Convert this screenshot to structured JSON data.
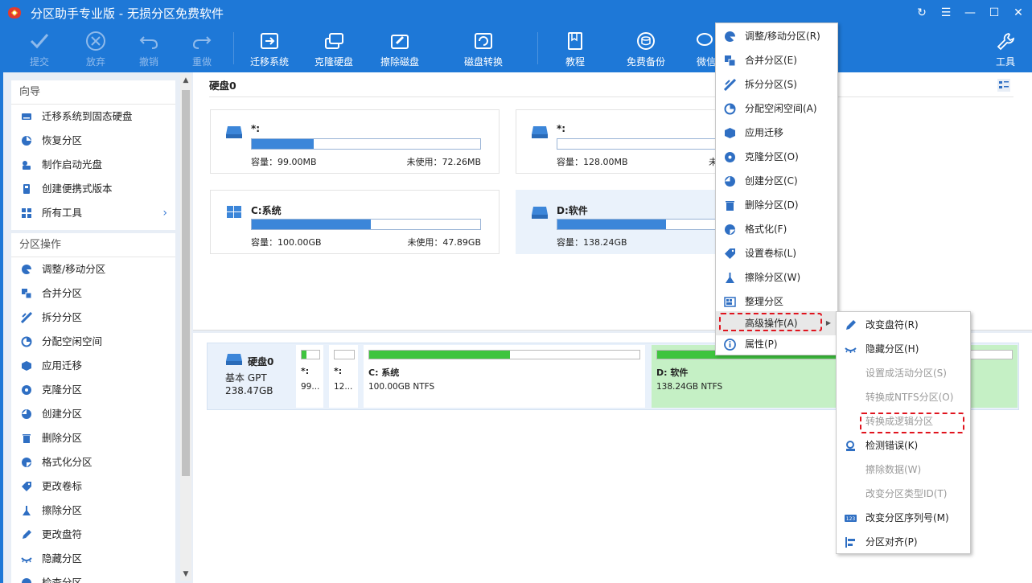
{
  "window": {
    "title": "分区助手专业版 - 无损分区免费软件",
    "controls": {
      "refresh": "↻",
      "menu": "☰",
      "minimize": "—",
      "maximize": "☐",
      "close": "✕"
    }
  },
  "toolbar": {
    "commit": "提交",
    "discard": "放弃",
    "undo": "撤销",
    "redo": "重做",
    "migrate_os": "迁移系统",
    "clone_disk": "克隆硬盘",
    "wipe_disk": "擦除磁盘",
    "disk_convert": "磁盘转换",
    "tutorial": "教程",
    "free_backup": "免费备份",
    "wechat": "微信",
    "tools": "工具"
  },
  "sidebar": {
    "wizard_title": "向导",
    "wizard_items": [
      {
        "label": "迁移系统到固态硬盘",
        "icon": "disk-migrate-icon"
      },
      {
        "label": "恢复分区",
        "icon": "recover-icon"
      },
      {
        "label": "制作启动光盘",
        "icon": "boot-disc-icon"
      },
      {
        "label": "创建便携式版本",
        "icon": "portable-icon"
      },
      {
        "label": "所有工具",
        "icon": "tools-grid-icon",
        "arrow": "›"
      }
    ],
    "ops_title": "分区操作",
    "ops_items": [
      {
        "label": "调整/移动分区"
      },
      {
        "label": "合并分区"
      },
      {
        "label": "拆分分区"
      },
      {
        "label": "分配空闲空间"
      },
      {
        "label": "应用迁移"
      },
      {
        "label": "克隆分区"
      },
      {
        "label": "创建分区"
      },
      {
        "label": "删除分区"
      },
      {
        "label": "格式化分区"
      },
      {
        "label": "更改卷标"
      },
      {
        "label": "擦除分区"
      },
      {
        "label": "更改盘符"
      },
      {
        "label": "隐藏分区"
      },
      {
        "label": "检查分区"
      }
    ]
  },
  "main": {
    "disk_title": "硬盘0",
    "cards": [
      {
        "name": "*:",
        "capacity": "容量：99.00MB",
        "unused": "未使用：72.26MB",
        "used_fraction": 0.27,
        "icon": "drive-icon"
      },
      {
        "name": "*:",
        "capacity": "容量：128.00MB",
        "unused": "未",
        "used_fraction": 0.0,
        "icon": "drive-icon"
      },
      {
        "name": "C:系统",
        "capacity": "容量：100.00GB",
        "unused": "未使用：47.89GB",
        "used_fraction": 0.52,
        "icon": "windows-icon"
      },
      {
        "name": "D:软件",
        "capacity": "容量：138.24GB",
        "unused": "",
        "used_fraction": 0.65,
        "icon": "drive-icon"
      }
    ],
    "disk_map": {
      "name": "硬盘0",
      "type": "基本 GPT",
      "size": "238.47GB",
      "partitions": [
        {
          "label": "*:",
          "info": "99...",
          "fill": 0.27
        },
        {
          "label": "*:",
          "info": "12...",
          "fill": 0.0
        },
        {
          "label": "C: 系统",
          "info": "100.00GB NTFS",
          "fill": 0.52
        },
        {
          "label": "D: 软件",
          "info": "138.24GB NTFS",
          "fill": 0.65
        }
      ]
    }
  },
  "context_menu": {
    "items": [
      {
        "label": "调整/移动分区(R)"
      },
      {
        "label": "合并分区(E)"
      },
      {
        "label": "拆分分区(S)"
      },
      {
        "label": "分配空闲空间(A)"
      },
      {
        "label": "应用迁移"
      },
      {
        "label": "克隆分区(O)"
      },
      {
        "label": "创建分区(C)"
      },
      {
        "label": "删除分区(D)"
      },
      {
        "label": "格式化(F)"
      },
      {
        "label": "设置卷标(L)"
      },
      {
        "label": "擦除分区(W)"
      },
      {
        "label": "整理分区"
      },
      {
        "label": "高级操作(A)"
      },
      {
        "label": "属性(P)"
      }
    ]
  },
  "submenu": {
    "items": [
      {
        "label": "改变盘符(R)",
        "enabled": true
      },
      {
        "label": "隐藏分区(H)",
        "enabled": true
      },
      {
        "label": "设置成活动分区(S)",
        "enabled": false
      },
      {
        "label": "转换成NTFS分区(O)",
        "enabled": false
      },
      {
        "label": "转换成逻辑分区",
        "enabled": false
      },
      {
        "label": "检测错误(K)",
        "enabled": true
      },
      {
        "label": "擦除数据(W)",
        "enabled": false
      },
      {
        "label": "改变分区类型ID(T)",
        "enabled": false
      },
      {
        "label": "改变分区序列号(M)",
        "enabled": true
      },
      {
        "label": "分区对齐(P)",
        "enabled": true
      }
    ]
  },
  "colors": {
    "accent": "#1e78d7",
    "bar_fill": "#3c86d9",
    "green": "#3ec43e",
    "highlight": "#e0141e"
  }
}
